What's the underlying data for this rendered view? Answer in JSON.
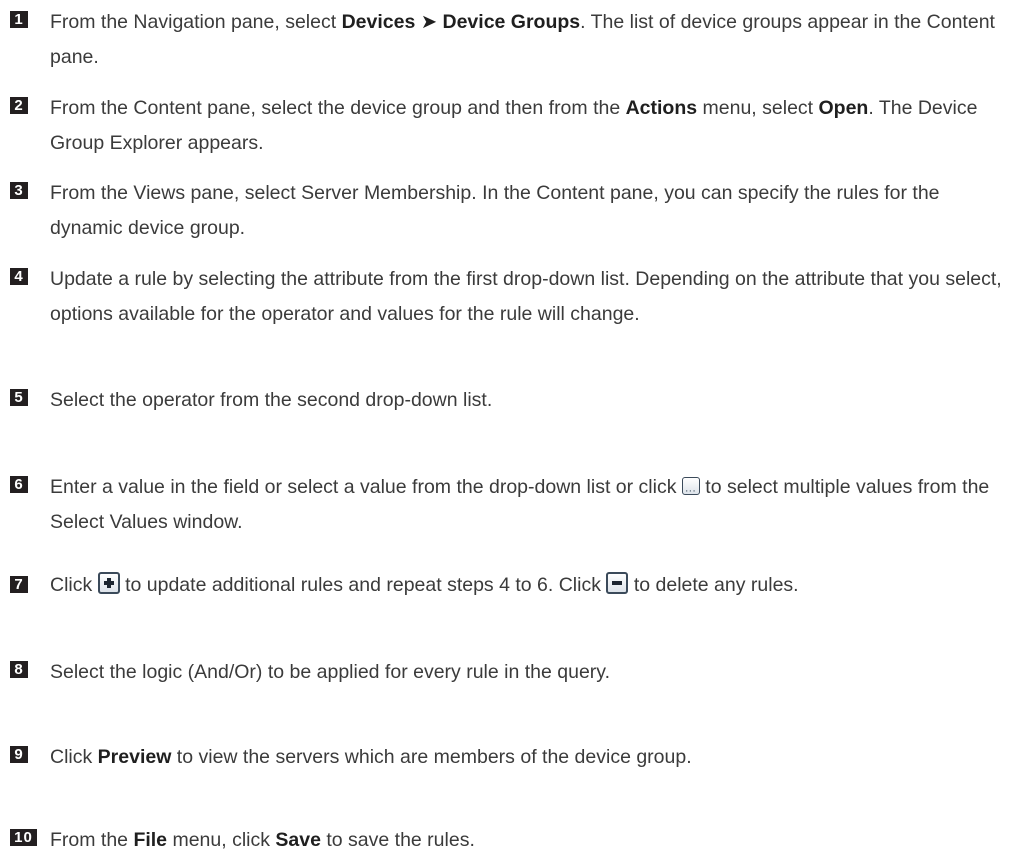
{
  "steps": [
    {
      "num": "1",
      "parts": [
        "From the Navigation pane, select ",
        "Devices",
        " ",
        "➤",
        " ",
        "Device Groups",
        ". The list of device groups appear in the Content pane."
      ]
    },
    {
      "num": "2",
      "parts": [
        "From the Content pane, select the device group and then from the ",
        "Actions",
        " menu, select ",
        "Open",
        ". The Device Group Explorer appears."
      ]
    },
    {
      "num": "3",
      "text": "From the Views pane, select Server Membership. In the Content pane, you can specify the rules for the dynamic device group."
    },
    {
      "num": "4",
      "text": "Update a rule by selecting the attribute from the first drop-down list. Depending on the attribute that you select, options available for the operator and values for the rule will change."
    },
    {
      "num": "5",
      "text": "Select the operator from the second drop-down list."
    },
    {
      "num": "6",
      "parts": [
        "Enter a value in the field or select a value from the drop-down list or click ",
        " to select multiple values from the Select Values window."
      ],
      "icon": "ellipsis-button-icon"
    },
    {
      "num": "7",
      "parts": [
        "Click ",
        " to update additional rules and repeat steps 4 to 6. Click ",
        " to delete any rules."
      ],
      "icons": [
        "add-rule-plus-icon",
        "delete-rule-minus-icon"
      ]
    },
    {
      "num": "8",
      "text": "Select the logic (And/Or) to be applied for every rule in the query."
    },
    {
      "num": "9",
      "parts": [
        "Click ",
        "Preview",
        " to view the servers which are members of the device group."
      ]
    },
    {
      "num": "10",
      "parts": [
        "From the ",
        "File",
        " menu, click ",
        "Save",
        " to save the rules."
      ]
    }
  ]
}
